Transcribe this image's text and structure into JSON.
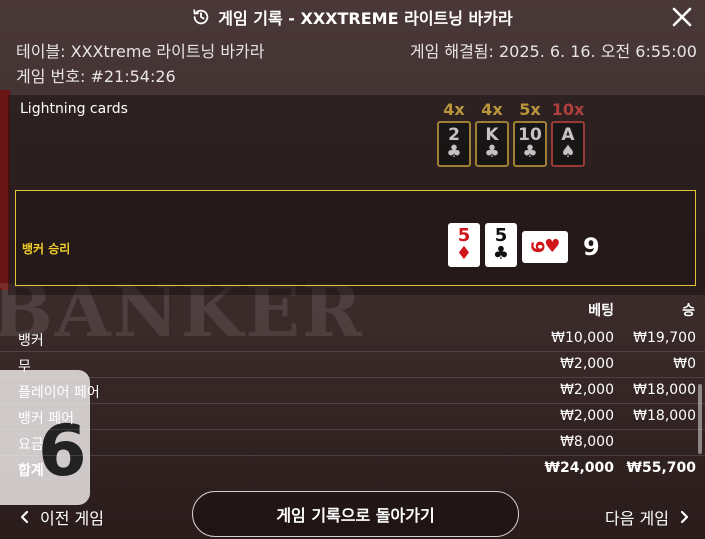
{
  "header": {
    "title": "게임 기록 - XXXTREME 라이트닝 바카라"
  },
  "info": {
    "table": "테이블: XXXtreme 라이트닝 바카라",
    "game_number": "게임 번호: #21:54:26",
    "resolved": "게임 해결됨: 2025. 6. 16. 오전 6:55:00"
  },
  "lightning": {
    "label": "Lightning cards",
    "cards": [
      {
        "mult": "4x",
        "rank": "2",
        "suit": "♣",
        "tone": "gold"
      },
      {
        "mult": "4x",
        "rank": "K",
        "suit": "♣",
        "tone": "gold"
      },
      {
        "mult": "5x",
        "rank": "10",
        "suit": "♣",
        "tone": "gold"
      },
      {
        "mult": "10x",
        "rank": "A",
        "suit": "♠",
        "tone": "red"
      }
    ]
  },
  "result": {
    "label": "뱅커 승리",
    "cards": [
      {
        "rank": "5",
        "suit": "♦",
        "color": "red"
      },
      {
        "rank": "5",
        "suit": "♣",
        "color": "black"
      },
      {
        "rank": "9",
        "suit": "♥",
        "color": "red"
      }
    ],
    "score": "9"
  },
  "bets": {
    "col_bet": "베팅",
    "col_win": "승",
    "rows": [
      {
        "name": "뱅커",
        "bet": "₩10,000",
        "win": "₩19,700"
      },
      {
        "name": "무",
        "bet": "₩2,000",
        "win": "₩0"
      },
      {
        "name": "플레이어 페어",
        "bet": "₩2,000",
        "win": "₩18,000"
      },
      {
        "name": "뱅커 페어",
        "bet": "₩2,000",
        "win": "₩18,000"
      },
      {
        "name": "요금",
        "bet": "₩8,000",
        "win": ""
      }
    ],
    "total": {
      "name": "합계",
      "bet": "₩24,000",
      "win": "₩55,700"
    }
  },
  "background": {
    "word": "BANKER",
    "card_rank": "6"
  },
  "footer": {
    "prev": "이전 게임",
    "back": "게임 기록으로 돌아가기",
    "next": "다음 게임"
  },
  "colors": {
    "accent": "#f0cf2a",
    "gold": "#b8953a",
    "red": "#b0403d"
  }
}
